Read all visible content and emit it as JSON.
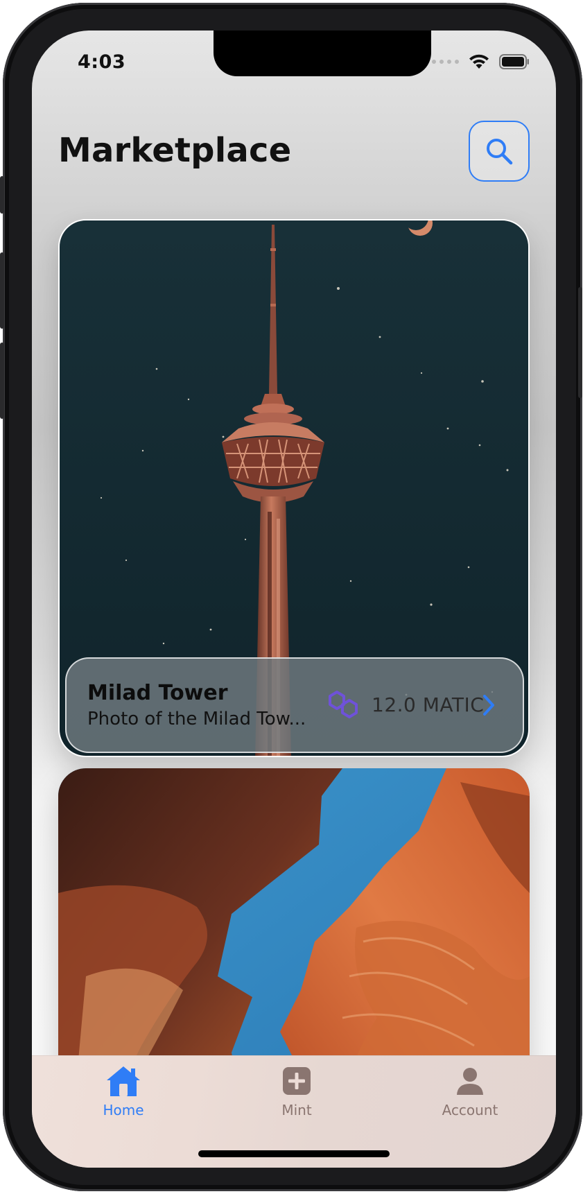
{
  "status_bar": {
    "time": "4:03"
  },
  "header": {
    "title": "Marketplace"
  },
  "cards": [
    {
      "name": "Milad Tower",
      "description": "Photo of the Milad Tow...",
      "price": "12.0 MATIC"
    }
  ],
  "tabs": [
    {
      "label": "Home",
      "icon": "house-icon",
      "selected": true
    },
    {
      "label": "Mint",
      "icon": "plus-square-icon",
      "selected": false
    },
    {
      "label": "Account",
      "icon": "person-icon",
      "selected": false
    }
  ],
  "colors": {
    "accent": "#2f7df6",
    "tab_inactive": "#8a7570",
    "matic": "#6f52d9"
  }
}
